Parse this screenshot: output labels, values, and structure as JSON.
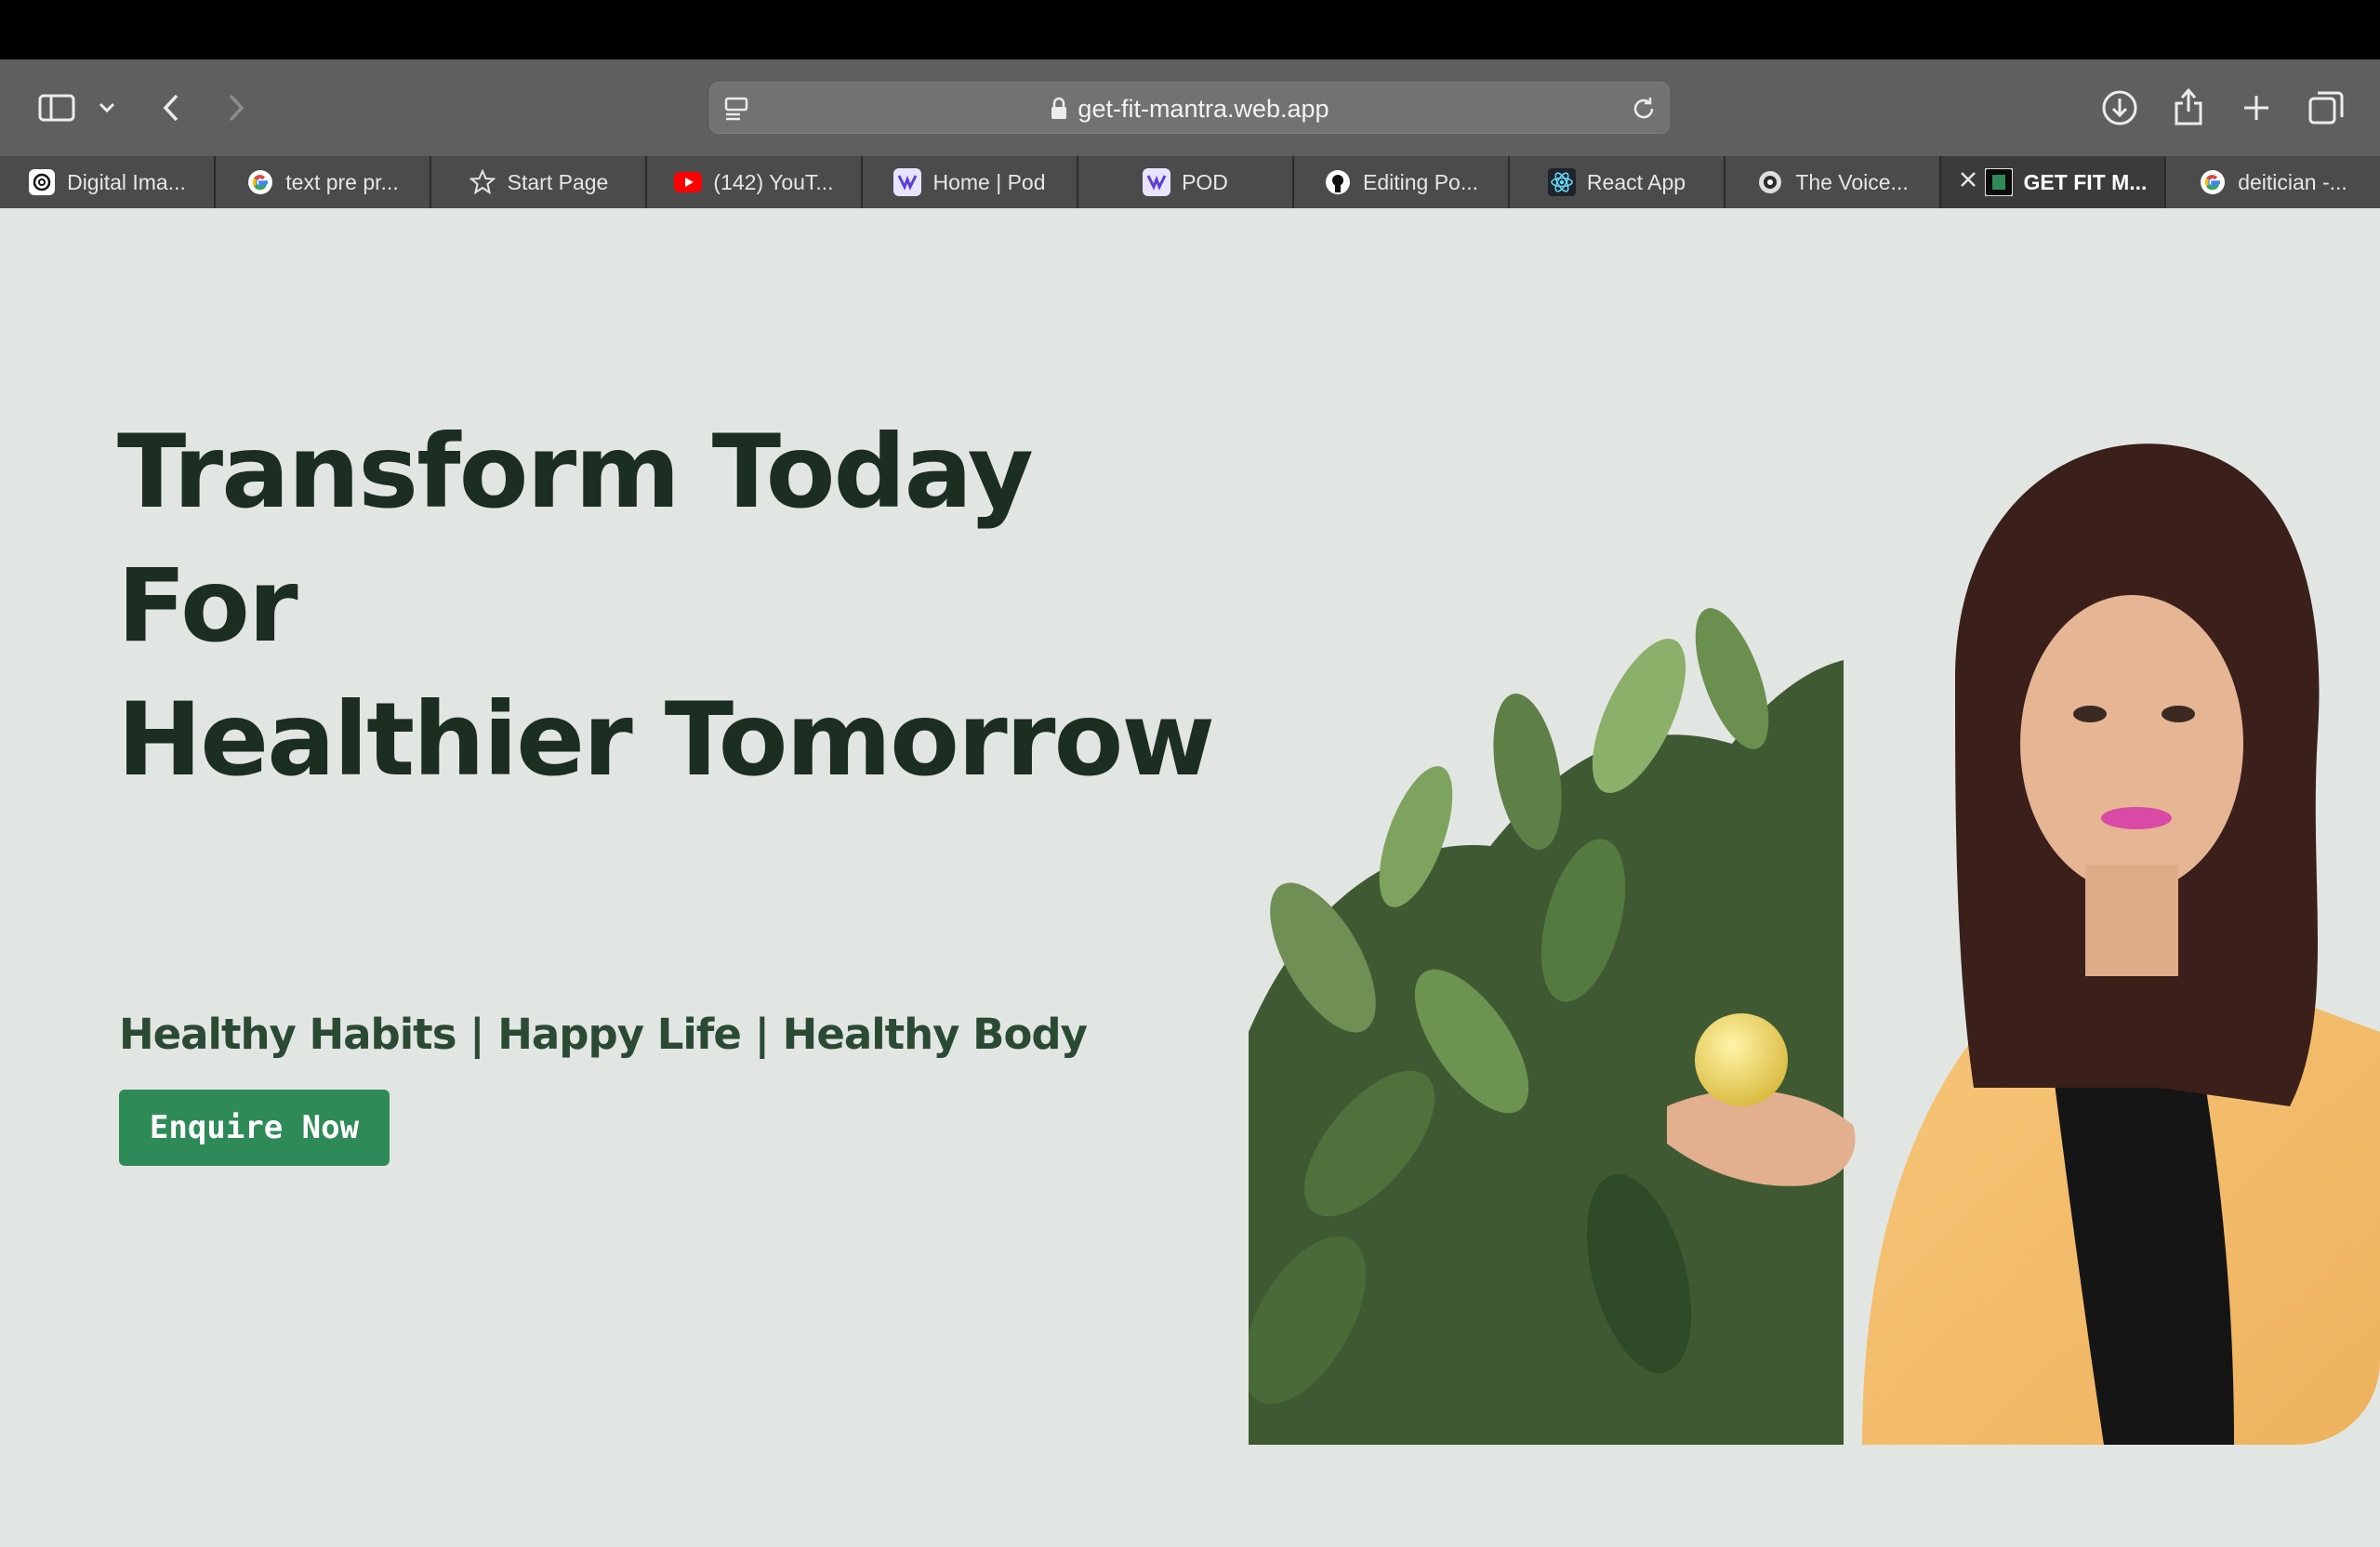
{
  "browser": {
    "url": "get-fit-mantra.web.app",
    "tabs": [
      {
        "label": "Digital Ima...",
        "icon": "openai-icon",
        "active": false
      },
      {
        "label": "text pre pr...",
        "icon": "google-icon",
        "active": false
      },
      {
        "label": "Start Page",
        "icon": "star-icon",
        "active": false
      },
      {
        "label": "(142) YouT...",
        "icon": "youtube-icon",
        "active": false
      },
      {
        "label": "Home | Pod",
        "icon": "pod-icon",
        "active": false
      },
      {
        "label": "POD",
        "icon": "pod-icon",
        "active": false
      },
      {
        "label": "Editing Po...",
        "icon": "github-icon",
        "active": false
      },
      {
        "label": "React App",
        "icon": "react-icon",
        "active": false
      },
      {
        "label": "The Voice...",
        "icon": "voice-icon",
        "active": false
      },
      {
        "label": "GET FIT M...",
        "icon": "getfit-icon",
        "active": true
      },
      {
        "label": "deitician -...",
        "icon": "google-icon",
        "active": false
      }
    ]
  },
  "hero": {
    "title_lines": [
      "Transform Today",
      "For",
      "Healthier Tomorrow"
    ],
    "subtitle": "Healthy Habits | Happy Life | Healthy Body",
    "cta_label": "Enquire Now"
  },
  "colors": {
    "page_bg": "#e2e6e2",
    "title": "#1c2e22",
    "cta_bg": "#2e8b57"
  }
}
